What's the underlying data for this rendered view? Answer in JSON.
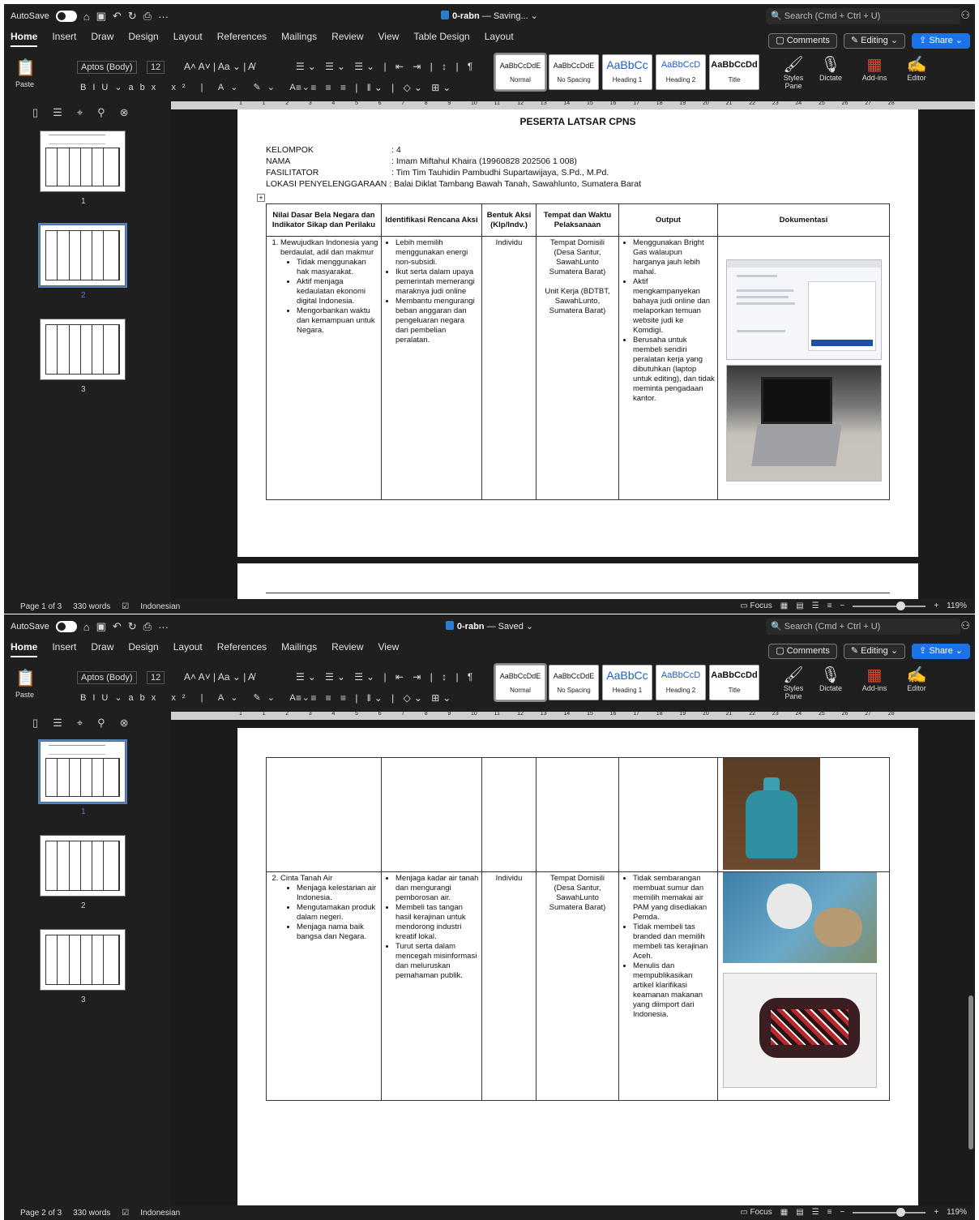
{
  "app": {
    "autosave": "AutoSave",
    "search_placeholder": "Search (Cmd + Ctrl + U)",
    "tabs": [
      "Home",
      "Insert",
      "Draw",
      "Design",
      "Layout",
      "References",
      "Mailings",
      "Review",
      "View"
    ],
    "contextual_tabs": [
      "Table Design",
      "Layout"
    ],
    "comments": "Comments",
    "editing": "Editing",
    "share": "Share",
    "font_name": "Aptos (Body)",
    "font_size": "12",
    "paste": "Paste",
    "styles": [
      {
        "preview": "AaBbCcDdE",
        "name": "Normal"
      },
      {
        "preview": "AaBbCcDdE",
        "name": "No Spacing"
      },
      {
        "preview": "AaBbCc",
        "name": "Heading 1"
      },
      {
        "preview": "AaBbCcD",
        "name": "Heading 2"
      },
      {
        "preview": "AaBbCcDd",
        "name": "Title"
      }
    ],
    "ribbon_right": [
      "Styles Pane",
      "Dictate",
      "Add-ins",
      "Editor"
    ],
    "ruler_marks": [
      "1",
      "1",
      "2",
      "3",
      "4",
      "5",
      "6",
      "7",
      "8",
      "9",
      "10",
      "11",
      "12",
      "13",
      "14",
      "15",
      "16",
      "17",
      "18",
      "19",
      "20",
      "21",
      "22",
      "23",
      "24",
      "25",
      "26",
      "27",
      "28"
    ],
    "thumb_labels": [
      "1",
      "2",
      "3"
    ],
    "word_count": "330 words",
    "language": "Indonesian",
    "focus": "Focus",
    "zoom": "119%"
  },
  "window1": {
    "doc_name": "0-rabn",
    "doc_status": "— Saving...",
    "page_status": "Page 1 of 3",
    "selected_thumb": "2"
  },
  "window2": {
    "doc_name": "0-rabn",
    "doc_status": "— Saved",
    "page_status": "Page 2 of 3",
    "selected_thumb": "1"
  },
  "document": {
    "heading": "PESERTA LATSAR CPNS",
    "meta": [
      {
        "key": "KELOMPOK",
        "value": ": 4"
      },
      {
        "key": "NAMA",
        "value": ": Imam Miftahul Khaira (19960828 202506 1 008)"
      },
      {
        "key": "FASILITATOR",
        "value": ": Tim Tim Tauhidin Pambudhi Supartawijaya, S.Pd., M.Pd."
      },
      {
        "key": "LOKASI PENYELENGGARAAN",
        "value": ": Balai Diklat Tambang Bawah Tanah, Sawahlunto, Sumatera Barat"
      }
    ],
    "headers": [
      "Nilai Dasar Bela Negara dan Indikator  Sikap dan Perilaku",
      "Identifikasi Rencana Aksi",
      "Bentuk Aksi (Klp/Indv.)",
      "Tempat dan Waktu Pelaksanaan",
      "Output",
      "Dokumentasi"
    ],
    "row1": {
      "value_title": "Mewujudkan Indonesia yang berdaulat, adil dan makmur",
      "indicators": [
        "Tidak menggunakan hak masyarakat.",
        "Aktif menjaga kedaulatan ekonomi digital Indonesia.",
        "Mengorbankan waktu dan kemampuan untuk Negara."
      ],
      "actions": [
        "Lebih memilih menggunakan energi non-subsidi.",
        "Ikut serta dalam upaya pemerintah memerangi maraknya judi online",
        "Membantu mengurangi beban anggaran dan pengeluaran negara dari pembelian peralatan."
      ],
      "form": "Individu",
      "place1": "Tempat Domisili (Desa Santur, SawahLunto Sumatera Barat)",
      "place2": "Unit Kerja (BDTBT, SawahLunto, Sumatera Barat)",
      "outputs": [
        "Menggunakan Bright Gas walaupun harganya jauh lebih mahal.",
        "Aktif mengkampanyekan bahaya judi online dan melaporkan temuan website judi ke Komdigi.",
        "Berusaha untuk membeli sendiri peralatan kerja yang dibutuhkan (laptop untuk editing), dan tidak meminta pengadaan kantor."
      ]
    },
    "row2": {
      "value_title": "Cinta Tanah Air",
      "indicators": [
        "Menjaga kelestarian air Indonesia.",
        "Mengutamakan produk dalam negeri.",
        "Menjaga nama baik bangsa dan Negara."
      ],
      "actions": [
        "Menjaga kadar air tanah dan mengurangi pemborosan air.",
        "Membeli tas tangan hasil kerajinan untuk mendorong industri kreatif lokal.",
        "Turut serta dalam mencegah misinformasi dan meluruskan pemahaman publik."
      ],
      "form": "Individu",
      "place": "Tempat Domisili (Desa Santur, SawahLunto Sumatera Barat)",
      "outputs": [
        "Tidak sembarangan membuat sumur dan memilih memakai air PAM yang disediakan Pemda.",
        "Tidak membeli tas branded dan memilih membeli tas kerajinan Aceh.",
        "Menulis dan mempublikasikan artikel klarifikasi keamanan makanan yang diimport dari Indonesia."
      ]
    }
  }
}
